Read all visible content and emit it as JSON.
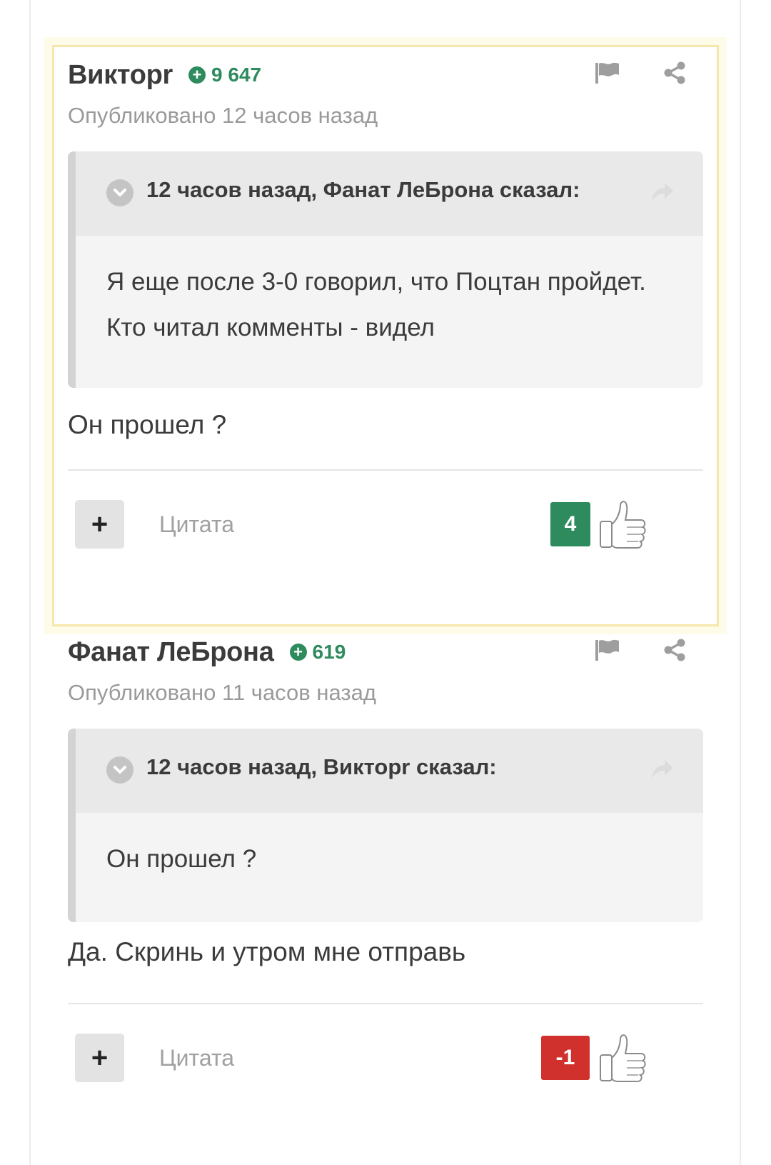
{
  "comments": [
    {
      "author": "Викторr",
      "reputation": "9 647",
      "published": "Опубликовано 12 часов назад",
      "quote": {
        "citation": "12 часов назад, Фанат ЛеБрона сказал:",
        "text": "Я еще после 3-0 говорил, что Поцтан пройдет. Кто читал комменты - видел"
      },
      "body": "Он прошел ?",
      "quote_label": "Цитата",
      "score": "4",
      "score_color": "#2e8b5e",
      "highlighted": true
    },
    {
      "author": "Фанат ЛеБрона",
      "reputation": "619",
      "published": "Опубликовано 11 часов назад",
      "quote": {
        "citation": "12 часов назад, Викторr сказал:",
        "text": "Он прошел ?"
      },
      "body": "Да. Скринь и утром мне отправь",
      "quote_label": "Цитата",
      "score": "-1",
      "score_color": "#d0312d",
      "highlighted": false
    }
  ],
  "icons": {
    "reputation": "plus-circle-icon",
    "report": "flag-icon",
    "share": "share-icon",
    "toggle": "chevron-down-icon",
    "goto": "reply-arrow-icon",
    "like": "thumbs-up-icon",
    "add": "plus-icon"
  },
  "colors": {
    "highlight_bg": "#fefbe8",
    "highlight_border": "#f6e7ad",
    "positive": "#2e8b5e",
    "negative": "#d0312d"
  }
}
